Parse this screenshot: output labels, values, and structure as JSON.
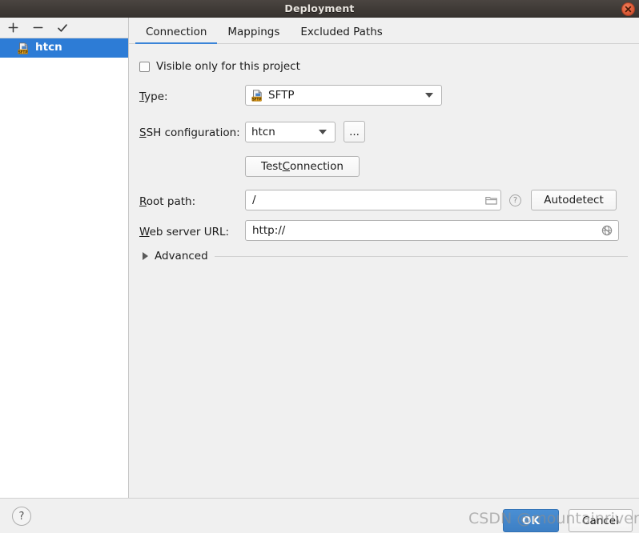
{
  "window": {
    "title": "Deployment",
    "close_icon": "close-icon"
  },
  "sidebar": {
    "toolbar": [
      {
        "name": "add",
        "icon": "plus-icon",
        "label": "+"
      },
      {
        "name": "remove",
        "icon": "minus-icon",
        "label": "−"
      },
      {
        "name": "apply",
        "icon": "check-icon",
        "label": "✓"
      }
    ],
    "items": [
      {
        "label": "htcn",
        "icon": "sftp-server-icon",
        "selected": true
      }
    ]
  },
  "tabs": [
    {
      "label": "Connection",
      "active": true
    },
    {
      "label": "Mappings",
      "active": false
    },
    {
      "label": "Excluded Paths",
      "active": false
    }
  ],
  "form": {
    "visible_only_checkbox": {
      "label": "Visible only for this project",
      "checked": false
    },
    "type": {
      "label_pre": "T",
      "label_post": "ype:",
      "value": "SFTP",
      "icon": "sftp-type-icon"
    },
    "ssh_configuration": {
      "label_pre": "S",
      "label_post": "SH configuration:",
      "value": "htcn",
      "browse_label": "..."
    },
    "test_connection": {
      "label_a": "Test ",
      "label_mnem": "C",
      "label_b": "onnection"
    },
    "root_path": {
      "label_pre": "R",
      "label_post": "oot path:",
      "value": "/",
      "folder_icon": "folder-icon",
      "help_icon": "help-icon",
      "autodetect_label": "Autodetect"
    },
    "web_server_url": {
      "label_pre": "W",
      "label_post": "eb server URL:",
      "value": "http://",
      "globe_icon": "globe-icon"
    },
    "advanced": {
      "label": "Advanced",
      "expanded": false
    }
  },
  "footer": {
    "help_label": "?",
    "ok_label": "OK",
    "cancel_label": "Cancel"
  },
  "watermark": {
    "text": "CSDN @mountainriver"
  },
  "colors": {
    "accent": "#3a84d8",
    "selection": "#2d7cd6",
    "panel": "#f0f0f0",
    "titlebar": "#3f3a36",
    "close": "#e0603c"
  }
}
